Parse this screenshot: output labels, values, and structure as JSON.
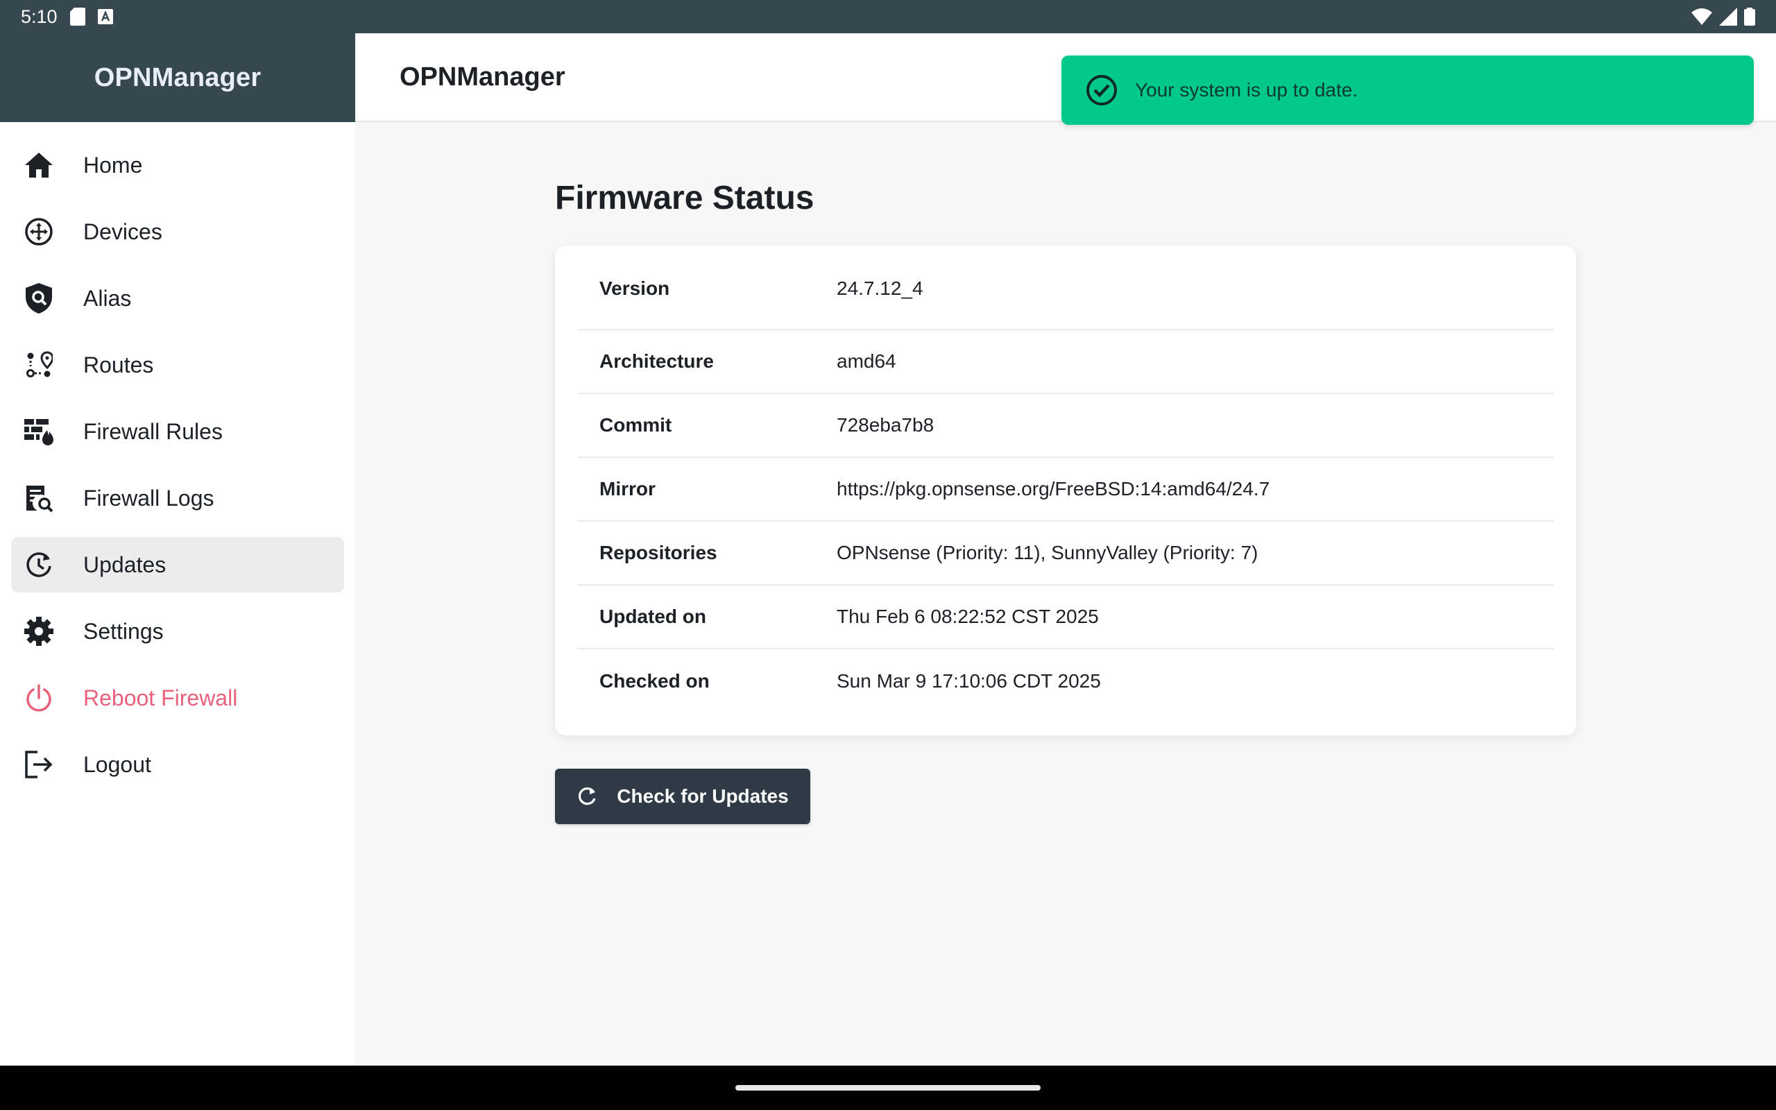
{
  "status_bar": {
    "time": "5:10"
  },
  "sidebar": {
    "app_title": "OPNManager",
    "items": [
      {
        "label": "Home",
        "icon": "home-icon"
      },
      {
        "label": "Devices",
        "icon": "devices-icon"
      },
      {
        "label": "Alias",
        "icon": "alias-shield-icon"
      },
      {
        "label": "Routes",
        "icon": "routes-icon"
      },
      {
        "label": "Firewall Rules",
        "icon": "firewall-rules-icon"
      },
      {
        "label": "Firewall Logs",
        "icon": "firewall-logs-icon"
      },
      {
        "label": "Updates",
        "icon": "updates-icon",
        "active": true
      },
      {
        "label": "Settings",
        "icon": "gear-icon"
      },
      {
        "label": "Reboot Firewall",
        "icon": "power-icon",
        "color": "#e8607a"
      },
      {
        "label": "Logout",
        "icon": "logout-icon"
      }
    ]
  },
  "header": {
    "title": "OPNManager"
  },
  "toast": {
    "message": "Your system is up to date.",
    "color": "#00c98b"
  },
  "main": {
    "title": "Firmware Status",
    "rows": [
      {
        "key": "Version",
        "value": "24.7.12_4"
      },
      {
        "key": "Architecture",
        "value": "amd64"
      },
      {
        "key": "Commit",
        "value": "728eba7b8"
      },
      {
        "key": "Mirror",
        "value": "https://pkg.opnsense.org/FreeBSD:14:amd64/24.7"
      },
      {
        "key": "Repositories",
        "value": "OPNsense (Priority: 11), SunnyValley (Priority: 7)"
      },
      {
        "key": "Updated on",
        "value": "Thu Feb 6 08:22:52 CST 2025"
      },
      {
        "key": "Checked on",
        "value": "Sun Mar 9 17:10:06 CDT 2025"
      }
    ],
    "check_button_label": "Check for Updates"
  },
  "colors": {
    "header_bg": "#37474f",
    "danger": "#e8607a",
    "button_bg": "#2e3a45",
    "success": "#00c98b"
  }
}
